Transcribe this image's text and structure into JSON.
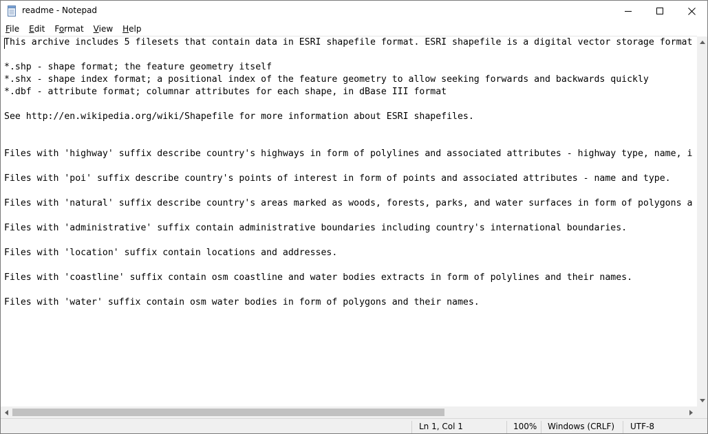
{
  "window": {
    "title": "readme - Notepad",
    "icons": {
      "app": "notepad-icon",
      "minimize": "minimize-icon",
      "maximize": "maximize-icon",
      "close": "close-icon"
    }
  },
  "menu": {
    "items": [
      {
        "label": "File",
        "mnemonic": "F",
        "rest": "ile"
      },
      {
        "label": "Edit",
        "mnemonic": "E",
        "rest": "dit"
      },
      {
        "label": "Format",
        "mnemonic": "o",
        "pre": "F",
        "rest": "rmat"
      },
      {
        "label": "View",
        "mnemonic": "V",
        "rest": "iew"
      },
      {
        "label": "Help",
        "mnemonic": "H",
        "rest": "elp"
      }
    ]
  },
  "editor": {
    "lines": [
      "This archive includes 5 filesets that contain data in ESRI shapefile format. ESRI shapefile is a digital vector storage format",
      "",
      "*.shp - shape format; the feature geometry itself",
      "*.shx - shape index format; a positional index of the feature geometry to allow seeking forwards and backwards quickly",
      "*.dbf - attribute format; columnar attributes for each shape, in dBase III format",
      "",
      "See http://en.wikipedia.org/wiki/Shapefile for more information about ESRI shapefiles.",
      "",
      "",
      "Files with 'highway' suffix describe country's highways in form of polylines and associated attributes - highway type, name, i",
      "",
      "Files with 'poi' suffix describe country's points of interest in form of points and associated attributes - name and type.",
      "",
      "Files with 'natural' suffix describe country's areas marked as woods, forests, parks, and water surfaces in form of polygons a",
      "",
      "Files with 'administrative' suffix contain administrative boundaries including country's international boundaries.",
      "",
      "Files with 'location' suffix contain locations and addresses.",
      "",
      "Files with 'coastline' suffix contain osm coastline and water bodies extracts in form of polylines and their names.",
      "",
      "Files with 'water' suffix contain osm water bodies in form of polygons and their names."
    ]
  },
  "scrollbars": {
    "icons": {
      "up": "arrow-up-icon",
      "down": "arrow-down-icon",
      "left": "arrow-left-icon",
      "right": "arrow-right-icon"
    }
  },
  "status": {
    "position": "Ln 1, Col 1",
    "zoom": "100%",
    "line_ending": "Windows (CRLF)",
    "encoding": "UTF-8"
  }
}
